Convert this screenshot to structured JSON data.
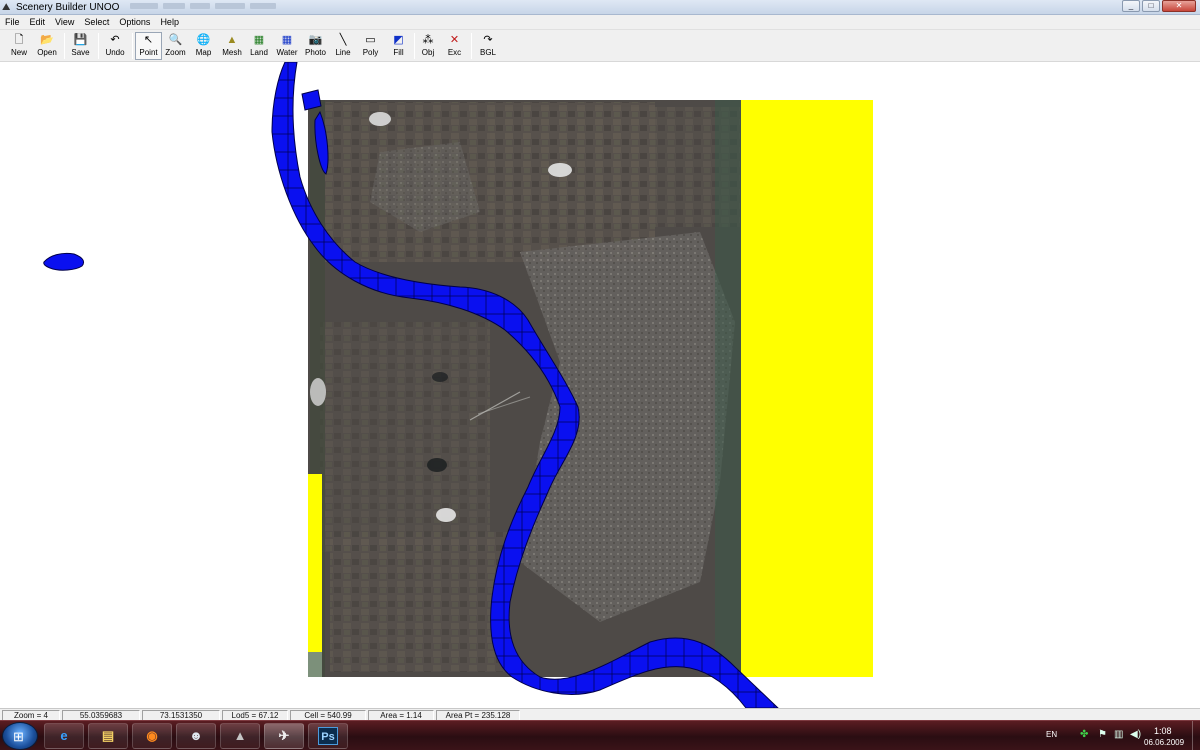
{
  "window": {
    "title": "Scenery Builder  UNOO",
    "minimize": "_",
    "maximize": "□",
    "close": "✕"
  },
  "menu": [
    "File",
    "Edit",
    "View",
    "Select",
    "Options",
    "Help"
  ],
  "toolbar": [
    {
      "label": "New",
      "icon": "new-file-icon",
      "glyph": "🗋"
    },
    {
      "label": "Open",
      "icon": "open-folder-icon",
      "glyph": "📂"
    },
    {
      "label": "Save",
      "icon": "save-disk-icon",
      "glyph": "💾"
    },
    {
      "label": "Undo",
      "icon": "undo-arrow-icon",
      "glyph": "↶"
    },
    {
      "label": "Point",
      "icon": "pointer-arrow-icon",
      "glyph": "↖"
    },
    {
      "label": "Zoom",
      "icon": "magnifier-icon",
      "glyph": "🔍"
    },
    {
      "label": "Map",
      "icon": "globe-icon",
      "glyph": "🌐"
    },
    {
      "label": "Mesh",
      "icon": "mesh-terrain-icon",
      "glyph": "▲"
    },
    {
      "label": "Land",
      "icon": "land-class-icon",
      "glyph": "▦"
    },
    {
      "label": "Water",
      "icon": "water-class-icon",
      "glyph": "▦"
    },
    {
      "label": "Photo",
      "icon": "camera-icon",
      "glyph": "📷"
    },
    {
      "label": "Line",
      "icon": "line-tool-icon",
      "glyph": "╲"
    },
    {
      "label": "Poly",
      "icon": "polygon-tool-icon",
      "glyph": "▭"
    },
    {
      "label": "Fill",
      "icon": "fill-tool-icon",
      "glyph": "◩"
    },
    {
      "label": "Obj",
      "icon": "object-nodes-icon",
      "glyph": "⁂"
    },
    {
      "label": "Exc",
      "icon": "exclude-x-icon",
      "glyph": "✕"
    },
    {
      "label": "BGL",
      "icon": "compile-bgl-icon",
      "glyph": "↷"
    }
  ],
  "status": [
    "Zoom = 4",
    "55.0359683",
    "73.1531350",
    "Lod5 = 67.12",
    "Cell = 540.99",
    "Area = 1.14",
    "Area Pt = 235.128"
  ],
  "taskbar": {
    "start_glyph": "⊞",
    "apps": [
      {
        "name": "internet-explorer-icon",
        "glyph": "e",
        "cls": "ie"
      },
      {
        "name": "file-explorer-icon",
        "glyph": "▤",
        "cls": "folder"
      },
      {
        "name": "firefox-icon",
        "glyph": "◉",
        "cls": "ff"
      },
      {
        "name": "alien-app-icon",
        "glyph": "☻",
        "cls": "alien"
      },
      {
        "name": "triangle-app-icon",
        "glyph": "▲",
        "cls": "tri"
      },
      {
        "name": "flight-simulator-icon",
        "glyph": "✈",
        "cls": "plane"
      },
      {
        "name": "photoshop-icon",
        "glyph": "Ps",
        "cls": "ps"
      }
    ],
    "tray": {
      "language": "EN",
      "time": "1:08",
      "date": "06.06.2009"
    }
  },
  "colors": {
    "water": "#0a10f0",
    "water_outline": "#00004a",
    "exclusion": "#ffff00",
    "photo_base": "#4e4a47"
  }
}
